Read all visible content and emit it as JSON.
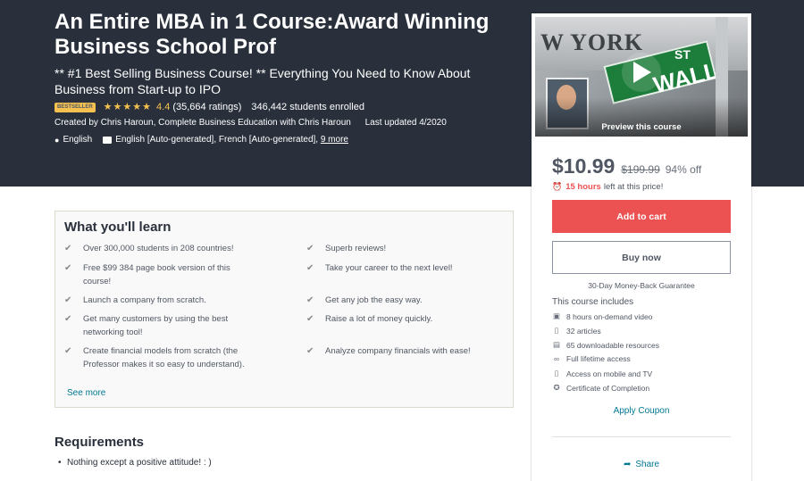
{
  "header": {
    "title": "An Entire MBA in 1 Course:Award Winning Business School Prof",
    "subtitle": "** #1 Best Selling Business Course! ** Everything You Need to Know About Business from Start-up to IPO",
    "badge": "BESTSELLER",
    "rating": "4.4",
    "ratings_count": "(35,664 ratings)",
    "students": "346,442 students enrolled",
    "created_by": "Created by Chris Haroun, Complete Business Education with Chris Haroun",
    "last_updated": "Last updated 4/2020",
    "language": "English",
    "captions": "English [Auto-generated], French [Auto-generated],",
    "captions_more": "9 more"
  },
  "learn": {
    "title": "What you'll learn",
    "items_left": [
      "Over 300,000 students in 208 countries!",
      "Free $99 384 page book version of this course!",
      "Launch a company from scratch.",
      "Get many customers by using the best networking tool!",
      "Create financial models from scratch (the Professor makes it so easy to understand)."
    ],
    "items_right": [
      "Superb reviews!",
      "Take your career to the next level!",
      "Get any job the easy way.",
      "Raise a lot of money quickly.",
      "Analyze company financials with ease!"
    ],
    "see_more": "See more"
  },
  "requirements": {
    "title": "Requirements",
    "items": [
      "Nothing except a positive attitude! : )"
    ]
  },
  "sidebar": {
    "preview_label": "Preview this course",
    "preview_sign_text": "W YORK",
    "preview_street_text": "WALL",
    "preview_st_text": "ST",
    "price": "$10.99",
    "old_price": "$199.99",
    "discount": "94% off",
    "timer_hours": "15 hours",
    "timer_text": "left at this price!",
    "add_to_cart": "Add to cart",
    "buy_now": "Buy now",
    "guarantee": "30-Day Money-Back Guarantee",
    "includes_title": "This course includes",
    "includes": [
      {
        "icon": "video-icon",
        "text": "8 hours on-demand video"
      },
      {
        "icon": "file-icon",
        "text": "32 articles"
      },
      {
        "icon": "download-icon",
        "text": "65 downloadable resources"
      },
      {
        "icon": "infinity-icon",
        "text": "Full lifetime access"
      },
      {
        "icon": "mobile-icon",
        "text": "Access on mobile and TV"
      },
      {
        "icon": "certificate-icon",
        "text": "Certificate of Completion"
      }
    ],
    "apply_coupon": "Apply Coupon",
    "share": "Share"
  },
  "colors": {
    "hero_bg": "#29303b",
    "star": "#f4c150",
    "cart_button": "#ec5252",
    "link": "#007791"
  }
}
